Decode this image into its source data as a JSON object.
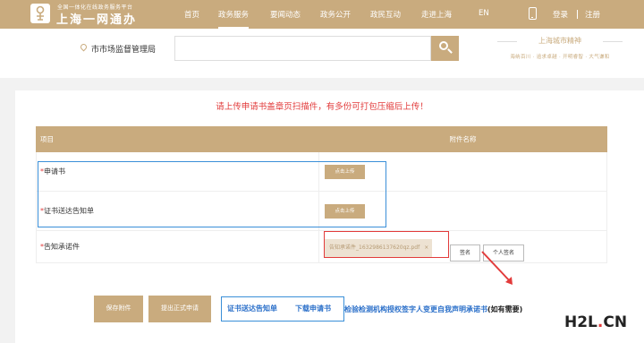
{
  "brand": {
    "subtitle": "全国一体化在线政务服务平台",
    "name": "上海一网通办"
  },
  "nav": {
    "items": [
      "首页",
      "政务服务",
      "要闻动态",
      "政务公开",
      "政民互动",
      "走进上海",
      "EN"
    ],
    "login": "登录",
    "register": "注册"
  },
  "search": {
    "region": "市市场监督管理局",
    "placeholder": ""
  },
  "spirit": {
    "title": "上海城市精神",
    "subtitle": "海纳百川 · 追求卓越 · 开明睿智 · 大气谦和"
  },
  "notice": "请上传申请书盖章页扫描件，有多份可打包压缩后上传！",
  "table": {
    "col_item": "项目",
    "col_attach": "附件名称",
    "rows": [
      {
        "star": "*",
        "label": "申请书",
        "button": "点击上传"
      },
      {
        "star": "*",
        "label": "证书送达告知单",
        "button": "点击上传"
      },
      {
        "star": "*",
        "label": "告知承诺件",
        "file": "告知承诺件_1632986137620qz.pdf",
        "file_close": "×",
        "sign": "签名",
        "personal_sign": "个人签名"
      }
    ]
  },
  "footer": {
    "save": "保存附件",
    "submit": "提出正式申请",
    "link1": "证书送达告知单",
    "link2": "下载申请书",
    "notice_blue": "检验检测机构授权签字人变更自我声明承诺书",
    "notice_dark": "(如有需要)"
  },
  "watermark": {
    "prefix": "H2L",
    "dot": ".",
    "suffix": "CN"
  },
  "colors": {
    "brand": "#c9ab7e",
    "red": "#e23b3b",
    "blue": "#3a8fd8"
  },
  "icons": [
    "logo-icon",
    "phone-icon",
    "location-pin-icon",
    "search-icon",
    "close-icon",
    "arrow-icon"
  ]
}
